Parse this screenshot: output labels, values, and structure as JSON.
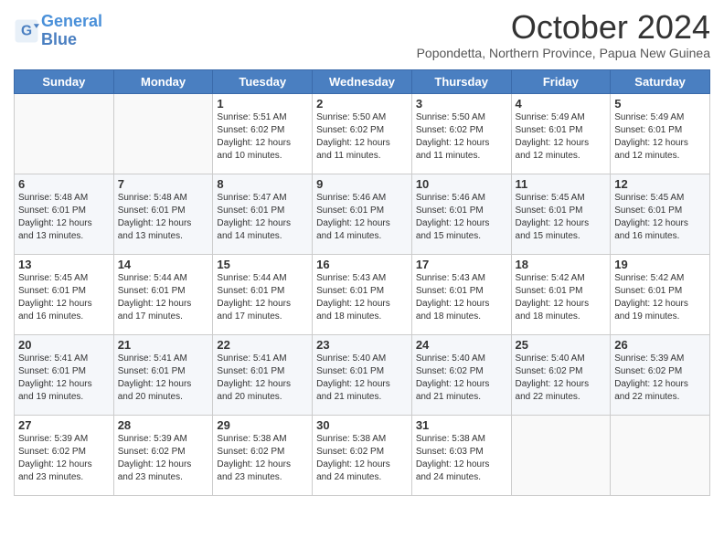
{
  "header": {
    "logo_line1": "General",
    "logo_line2": "Blue",
    "month_title": "October 2024",
    "location": "Popondetta, Northern Province, Papua New Guinea"
  },
  "weekdays": [
    "Sunday",
    "Monday",
    "Tuesday",
    "Wednesday",
    "Thursday",
    "Friday",
    "Saturday"
  ],
  "rows": [
    [
      {
        "day": "",
        "sunrise": "",
        "sunset": "",
        "daylight": ""
      },
      {
        "day": "",
        "sunrise": "",
        "sunset": "",
        "daylight": ""
      },
      {
        "day": "1",
        "sunrise": "Sunrise: 5:51 AM",
        "sunset": "Sunset: 6:02 PM",
        "daylight": "Daylight: 12 hours and 10 minutes."
      },
      {
        "day": "2",
        "sunrise": "Sunrise: 5:50 AM",
        "sunset": "Sunset: 6:02 PM",
        "daylight": "Daylight: 12 hours and 11 minutes."
      },
      {
        "day": "3",
        "sunrise": "Sunrise: 5:50 AM",
        "sunset": "Sunset: 6:02 PM",
        "daylight": "Daylight: 12 hours and 11 minutes."
      },
      {
        "day": "4",
        "sunrise": "Sunrise: 5:49 AM",
        "sunset": "Sunset: 6:01 PM",
        "daylight": "Daylight: 12 hours and 12 minutes."
      },
      {
        "day": "5",
        "sunrise": "Sunrise: 5:49 AM",
        "sunset": "Sunset: 6:01 PM",
        "daylight": "Daylight: 12 hours and 12 minutes."
      }
    ],
    [
      {
        "day": "6",
        "sunrise": "Sunrise: 5:48 AM",
        "sunset": "Sunset: 6:01 PM",
        "daylight": "Daylight: 12 hours and 13 minutes."
      },
      {
        "day": "7",
        "sunrise": "Sunrise: 5:48 AM",
        "sunset": "Sunset: 6:01 PM",
        "daylight": "Daylight: 12 hours and 13 minutes."
      },
      {
        "day": "8",
        "sunrise": "Sunrise: 5:47 AM",
        "sunset": "Sunset: 6:01 PM",
        "daylight": "Daylight: 12 hours and 14 minutes."
      },
      {
        "day": "9",
        "sunrise": "Sunrise: 5:46 AM",
        "sunset": "Sunset: 6:01 PM",
        "daylight": "Daylight: 12 hours and 14 minutes."
      },
      {
        "day": "10",
        "sunrise": "Sunrise: 5:46 AM",
        "sunset": "Sunset: 6:01 PM",
        "daylight": "Daylight: 12 hours and 15 minutes."
      },
      {
        "day": "11",
        "sunrise": "Sunrise: 5:45 AM",
        "sunset": "Sunset: 6:01 PM",
        "daylight": "Daylight: 12 hours and 15 minutes."
      },
      {
        "day": "12",
        "sunrise": "Sunrise: 5:45 AM",
        "sunset": "Sunset: 6:01 PM",
        "daylight": "Daylight: 12 hours and 16 minutes."
      }
    ],
    [
      {
        "day": "13",
        "sunrise": "Sunrise: 5:45 AM",
        "sunset": "Sunset: 6:01 PM",
        "daylight": "Daylight: 12 hours and 16 minutes."
      },
      {
        "day": "14",
        "sunrise": "Sunrise: 5:44 AM",
        "sunset": "Sunset: 6:01 PM",
        "daylight": "Daylight: 12 hours and 17 minutes."
      },
      {
        "day": "15",
        "sunrise": "Sunrise: 5:44 AM",
        "sunset": "Sunset: 6:01 PM",
        "daylight": "Daylight: 12 hours and 17 minutes."
      },
      {
        "day": "16",
        "sunrise": "Sunrise: 5:43 AM",
        "sunset": "Sunset: 6:01 PM",
        "daylight": "Daylight: 12 hours and 18 minutes."
      },
      {
        "day": "17",
        "sunrise": "Sunrise: 5:43 AM",
        "sunset": "Sunset: 6:01 PM",
        "daylight": "Daylight: 12 hours and 18 minutes."
      },
      {
        "day": "18",
        "sunrise": "Sunrise: 5:42 AM",
        "sunset": "Sunset: 6:01 PM",
        "daylight": "Daylight: 12 hours and 18 minutes."
      },
      {
        "day": "19",
        "sunrise": "Sunrise: 5:42 AM",
        "sunset": "Sunset: 6:01 PM",
        "daylight": "Daylight: 12 hours and 19 minutes."
      }
    ],
    [
      {
        "day": "20",
        "sunrise": "Sunrise: 5:41 AM",
        "sunset": "Sunset: 6:01 PM",
        "daylight": "Daylight: 12 hours and 19 minutes."
      },
      {
        "day": "21",
        "sunrise": "Sunrise: 5:41 AM",
        "sunset": "Sunset: 6:01 PM",
        "daylight": "Daylight: 12 hours and 20 minutes."
      },
      {
        "day": "22",
        "sunrise": "Sunrise: 5:41 AM",
        "sunset": "Sunset: 6:01 PM",
        "daylight": "Daylight: 12 hours and 20 minutes."
      },
      {
        "day": "23",
        "sunrise": "Sunrise: 5:40 AM",
        "sunset": "Sunset: 6:01 PM",
        "daylight": "Daylight: 12 hours and 21 minutes."
      },
      {
        "day": "24",
        "sunrise": "Sunrise: 5:40 AM",
        "sunset": "Sunset: 6:02 PM",
        "daylight": "Daylight: 12 hours and 21 minutes."
      },
      {
        "day": "25",
        "sunrise": "Sunrise: 5:40 AM",
        "sunset": "Sunset: 6:02 PM",
        "daylight": "Daylight: 12 hours and 22 minutes."
      },
      {
        "day": "26",
        "sunrise": "Sunrise: 5:39 AM",
        "sunset": "Sunset: 6:02 PM",
        "daylight": "Daylight: 12 hours and 22 minutes."
      }
    ],
    [
      {
        "day": "27",
        "sunrise": "Sunrise: 5:39 AM",
        "sunset": "Sunset: 6:02 PM",
        "daylight": "Daylight: 12 hours and 23 minutes."
      },
      {
        "day": "28",
        "sunrise": "Sunrise: 5:39 AM",
        "sunset": "Sunset: 6:02 PM",
        "daylight": "Daylight: 12 hours and 23 minutes."
      },
      {
        "day": "29",
        "sunrise": "Sunrise: 5:38 AM",
        "sunset": "Sunset: 6:02 PM",
        "daylight": "Daylight: 12 hours and 23 minutes."
      },
      {
        "day": "30",
        "sunrise": "Sunrise: 5:38 AM",
        "sunset": "Sunset: 6:02 PM",
        "daylight": "Daylight: 12 hours and 24 minutes."
      },
      {
        "day": "31",
        "sunrise": "Sunrise: 5:38 AM",
        "sunset": "Sunset: 6:03 PM",
        "daylight": "Daylight: 12 hours and 24 minutes."
      },
      {
        "day": "",
        "sunrise": "",
        "sunset": "",
        "daylight": ""
      },
      {
        "day": "",
        "sunrise": "",
        "sunset": "",
        "daylight": ""
      }
    ]
  ]
}
